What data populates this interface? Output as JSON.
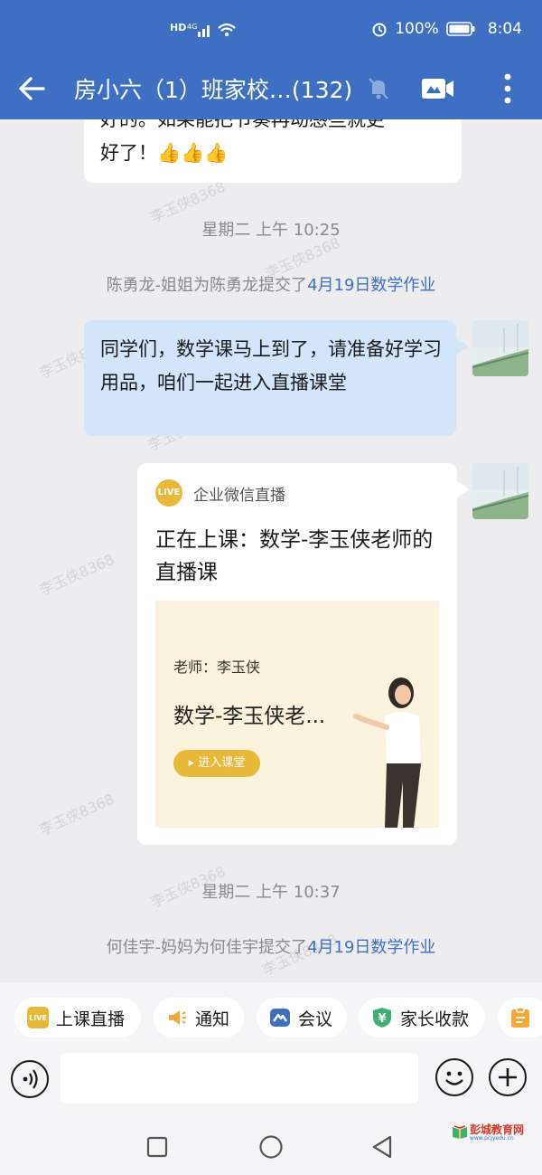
{
  "status_bar": {
    "network": "4G",
    "hd": "HD",
    "battery": "100%",
    "time": "8:04"
  },
  "header": {
    "title": "房小六（1）班家校…(132)"
  },
  "messages": {
    "partial_line1": "好的。如果能把节奏再动感些就更",
    "partial_line2": "好了！",
    "partial_emoji": "👍👍👍",
    "ts1": "星期二  上午 10:25",
    "sys1_prefix": "陈勇龙-姐姐为陈勇龙提交了",
    "sys1_link": "4月19日数学作业",
    "blue_text": "同学们，数学课马上到了，请准备好学习用品，咱们一起进入直播课堂",
    "ts2": "星期二  上午 10:37",
    "sys2_prefix": "何佳宇-妈妈为何佳宇提交了",
    "sys2_link": "4月19日数学作业"
  },
  "card": {
    "badge": "LIVE",
    "source": "企业微信直播",
    "title": "正在上课：数学-李玉侠老师的直播课",
    "teacher": "老师：李玉侠",
    "course": "数学-李玉侠老...",
    "enter": "进入课堂"
  },
  "watermark": "李玉侠8368",
  "toolbar": {
    "chips": [
      {
        "label": "上课直播",
        "icon": "live-icon",
        "color": "#e8b83b",
        "badge": "LIVE"
      },
      {
        "label": "通知",
        "icon": "megaphone-icon",
        "color": "#f2a83a"
      },
      {
        "label": "会议",
        "icon": "meeting-icon",
        "color": "#3f6fc2"
      },
      {
        "label": "家长收款",
        "icon": "yuan-shield-icon",
        "color": "#3bb273"
      }
    ],
    "badge_yuan": "¥"
  },
  "logo": {
    "name": "彭城教育网",
    "url": "www.pcjyedu.cn"
  }
}
